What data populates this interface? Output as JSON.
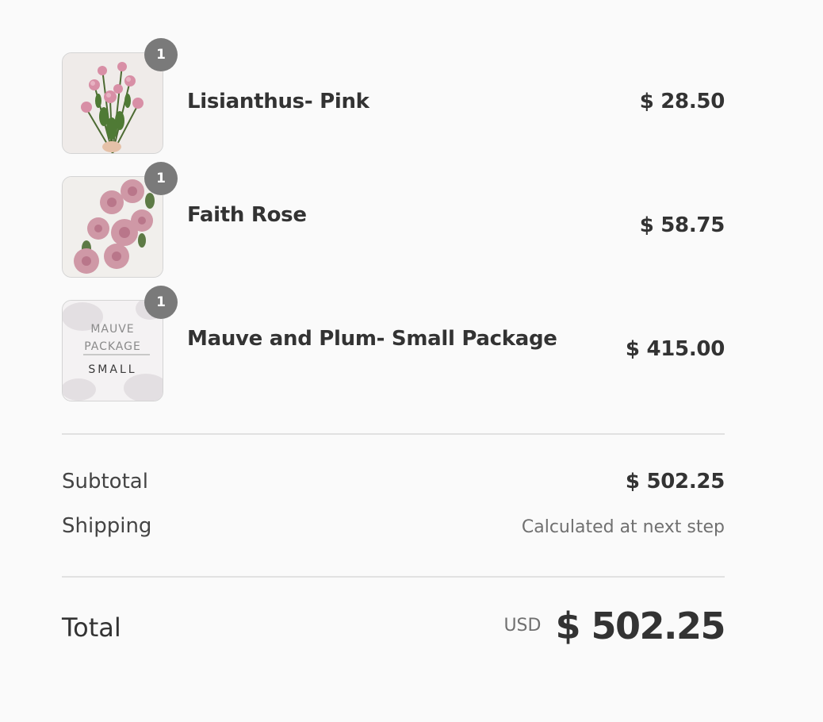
{
  "items": [
    {
      "name": "Lisianthus- Pink",
      "price": "$ 28.50",
      "quantity": "1",
      "image": "lisianthus-pink-bouquet"
    },
    {
      "name": "Faith Rose",
      "price": "$ 58.75",
      "quantity": "1",
      "image": "faith-rose-bouquet"
    },
    {
      "name": "Mauve and Plum- Small Package",
      "price": "$ 415.00",
      "quantity": "1",
      "image": "mauve-package-card",
      "image_text": {
        "line1": "MAUVE",
        "line2": "PACKAGE",
        "line3": "SMALL"
      }
    }
  ],
  "summary": {
    "subtotal_label": "Subtotal",
    "subtotal_value": "$ 502.25",
    "shipping_label": "Shipping",
    "shipping_value": "Calculated at next step",
    "total_label": "Total",
    "currency": "USD",
    "total_value": "$ 502.25"
  },
  "colors": {
    "background": "#fafafa",
    "text": "#333333",
    "muted_text": "#707070",
    "badge": "#7a7a7a",
    "divider": "#e1e1e1"
  }
}
